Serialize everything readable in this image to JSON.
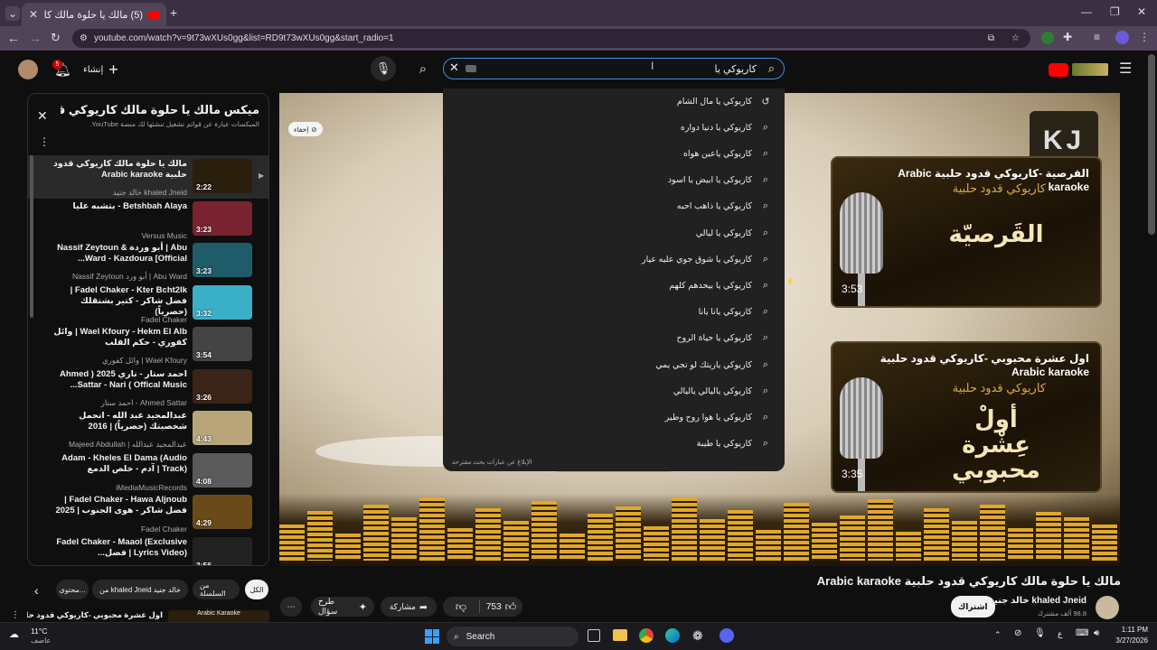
{
  "browser": {
    "tab_title": "(5) مالك يا حلوة مالك كاريوكي قد",
    "url": "youtube.com/watch?v=9t73wXUs0gg&list=RD9t73wXUs0gg&start_radio=1"
  },
  "masthead": {
    "search_value": "كاريوكي يا",
    "create_label": "إنشاء",
    "notifications_count": "5"
  },
  "suggestions": [
    "كاريوكي يا مال الشام",
    "كاريوكي يا دنيا دواره",
    "كاريوكي ياعين هواه",
    "كاريوكي يا ابيض يا اسود",
    "كاريوكي يا ذاهب احبه",
    "كاريوكي يا ليالي",
    "كاريوكي يا شوق جوي عليه عيار",
    "كاريوكي يا بيحدهم كلهم",
    "كاريوكي يانا يانا",
    "كاريوكي يا حياة الروح",
    "كاريوكي ياريتك لو تجي يمي",
    "كاريوكي ياليالي ياليالي",
    "كاريوكي يا هوا روح وطير",
    "كاريوكي يا طيبة"
  ],
  "suggestions_footer": "الإبلاغ عن عبارات بحث مقترحة",
  "playlist": {
    "title": "ميكس مالك يا حلوة مالك كاريوكي قد...",
    "subtitle": "المبكسات عبارة عن قوائم تشغيل تنشئها لك منصة YouTube.",
    "items": [
      {
        "title": "مالك يا حلوة مالك كاريوكي قدود حلبية Arabic karaoke",
        "channel": "khaled Jneid خالد جنيد",
        "duration": "2:22",
        "thumb": "#2a1e0c"
      },
      {
        "title": "Betshbah Alaya - بتشبه عليا",
        "channel": "Versus Music",
        "duration": "3:23",
        "thumb": "#7a2330"
      },
      {
        "title": "Abu | أبو وردة & Nassif Zeytoun Ward - Kazdoura [Official...",
        "channel": "Abu Ward | أبو ورد Nassif Zeytoun",
        "duration": "3:23",
        "thumb": "#1d5c68"
      },
      {
        "title": "Fadel Chaker - Kter Bcht2lk | فضل شاكر - كتير بشتقلك (حصرياً)",
        "channel": "Fadel Chaker",
        "duration": "3:32",
        "thumb": "#3ab0c8"
      },
      {
        "title": "Wael Kfoury - Hekm El Alb | وائل كفوري - حكم القلب",
        "channel": "Wael Kfoury | وائل كفوري",
        "duration": "3:54",
        "thumb": "#444444"
      },
      {
        "title": "احمد ستار - ناري 2025 ( Ahmed Sattar - Nari ( Offical Music...",
        "channel": "Ahmed Sattar - احمد ستار",
        "duration": "3:26",
        "thumb": "#3a2418"
      },
      {
        "title": "عبدالمجيد عبد الله - اتحمل شخصيتك (حصرياً) | 2016",
        "channel": "عبدالمجيد عبدالله | Majeed Abdullah",
        "duration": "4:43",
        "thumb": "#b8a57a"
      },
      {
        "title": "Adam - Kheles El Dama (Audio Track) | آدم - خلص الدمع",
        "channel": "iMediaMusicRecords",
        "duration": "4:08",
        "thumb": "#5a5a5a"
      },
      {
        "title": "Fadel Chaker - Hawa Aljnoub | فضل شاكر - هوى الجنوب | 2025",
        "channel": "Fadel Chaker",
        "duration": "4:29",
        "thumb": "#6a4a18"
      },
      {
        "title": "Fadel Chaker - Maaol (Exclusive Lyrics Video) | فضل...",
        "channel": "Fadel Chaker",
        "duration": "3:56",
        "thumb": "#222222"
      }
    ]
  },
  "player": {
    "overlay_logo": "KJ",
    "card1": {
      "title": "القرصية -كاريوكي قدود حلبية Arabic karaoke",
      "sub": "كاريوكي قدود حلبية",
      "big": "القَرصيّة",
      "duration": "3:53"
    },
    "card2": {
      "title": "اول عشرة محبوبي -كاريوكي قدود حلبية Arabic karaoke",
      "sub": "كاريوكي قدود حلبية",
      "big": "أولْ عِشْرة محبوبي",
      "duration": "3:35"
    },
    "hide_label": "إخفاء"
  },
  "video": {
    "title": "مالك يا حلوة مالك كاريوكي قدود حلبية Arabic karaoke",
    "channel": "khaled Jneid خالد جنيد",
    "subscribers": "98.8 ألف مشترك",
    "subscribe_label": "اشتراك",
    "likes": "753",
    "share_label": "مشاركة",
    "ask_label": "طرح سؤال"
  },
  "chips": [
    "الكل",
    "من السلسلة",
    "من khaled Jneid خالد جنيد",
    "محتوى..."
  ],
  "next_up": {
    "title": "اول عشرة محبوبي -كاريوكي قدود حلبية",
    "thumb_label": "Arabic Karaoke"
  },
  "taskbar": {
    "weather_temp": "11°C",
    "weather_desc": "عاصف",
    "search_placeholder": "Search",
    "time": "1:11 PM",
    "date": "3/27/2026",
    "lang": "ع"
  },
  "colors": {
    "accent": "#3ea6ff",
    "brand_red": "#ff0000",
    "gold": "#e0a82a"
  }
}
